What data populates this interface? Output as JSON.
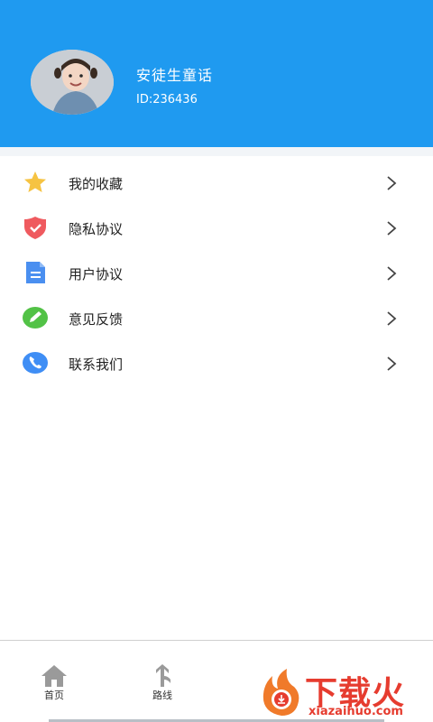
{
  "header": {
    "user_name": "安徒生童话",
    "user_id": "ID:236436"
  },
  "menu": {
    "items": [
      {
        "label": "我的收藏",
        "icon": "star-icon"
      },
      {
        "label": "隐私协议",
        "icon": "shield-check-icon"
      },
      {
        "label": "用户协议",
        "icon": "document-icon"
      },
      {
        "label": "意见反馈",
        "icon": "pencil-icon"
      },
      {
        "label": "联系我们",
        "icon": "phone-icon"
      }
    ]
  },
  "bottom_nav": {
    "items": [
      {
        "label": "首页",
        "icon": "home-icon"
      },
      {
        "label": "路线",
        "icon": "route-icon"
      }
    ]
  },
  "watermark": {
    "text": "下载火",
    "url": "xiazaihuo.com"
  },
  "colors": {
    "header_bg": "#1f9af0",
    "accent_red": "#e63c2f"
  }
}
